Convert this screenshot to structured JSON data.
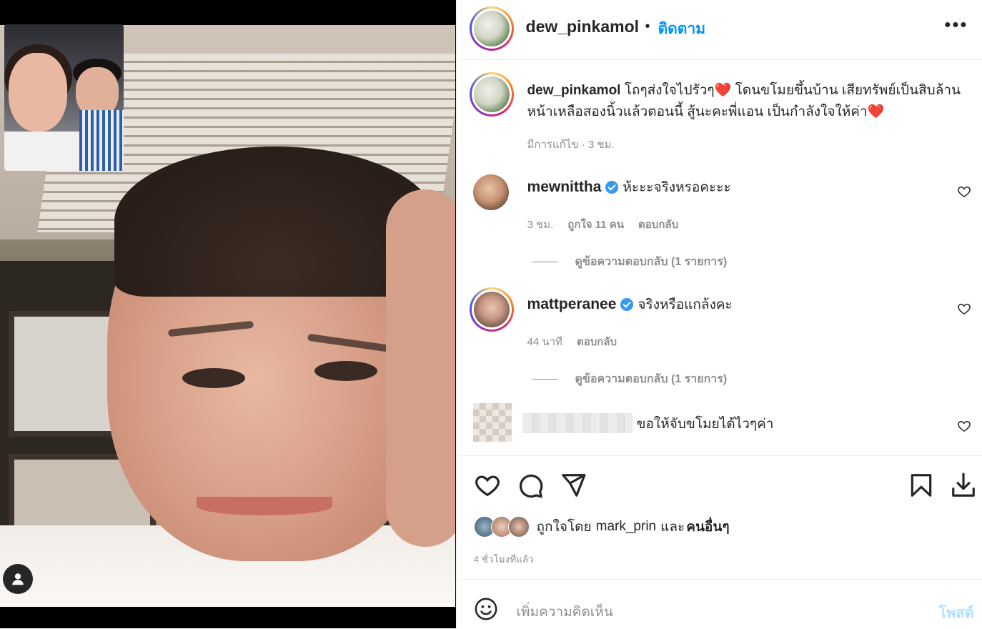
{
  "header": {
    "username": "dew_pinkamol",
    "separator": "•",
    "follow_label": "ติดตาม",
    "more_label": "•••"
  },
  "caption": {
    "username": "dew_pinkamol",
    "text": "โถๆส่งใจไปรัวๆ❤️ โดนขโมยขึ้นบ้าน เสียทรัพย์เป็นสิบล้าน หน้าเหลือสองนิ้วแล้วตอนนี้ สู้นะคะพี่แอน เป็นกำลังใจให้ค่า❤️",
    "meta": "มีการแก้ไข · 3 ชม."
  },
  "comments": [
    {
      "username": "mewnittha",
      "verified": true,
      "text": "ห้ะะะจริงหรอคะะะ",
      "time": "3 ชม.",
      "likes": "ถูกใจ 11 คน",
      "reply": "ตอบกลับ",
      "view_replies": "ดูข้อความตอบกลับ (1 รายการ)"
    },
    {
      "username": "mattperanee",
      "verified": true,
      "text": "จริงหรือแกล้งคะ",
      "time": "44 นาที",
      "reply": "ตอบกลับ",
      "view_replies": "ดูข้อความตอบกลับ (1 รายการ)"
    },
    {
      "username": "",
      "text": "ขอให้จับขโมยได้ไวๆค่า"
    }
  ],
  "actions": {
    "liked_prefix": "ถูกใจโดย",
    "liked_user": "mark_prin",
    "liked_and": "และ",
    "liked_others": "คนอื่นๆ",
    "time_ago": "4 ชั่วโมงที่แล้ว"
  },
  "comment_box": {
    "placeholder": "เพิ่มความคิดเห็น",
    "post_label": "โพสต์"
  },
  "icons": {
    "like": "heart-icon",
    "comment": "comment-icon",
    "share": "share-icon",
    "save": "bookmark-icon",
    "download": "download-icon",
    "emoji": "emoji-icon",
    "user_tag": "user-tag-icon"
  },
  "colors": {
    "link_blue": "#0095f6",
    "post_disabled": "#b2dffc",
    "verified": "#3897f0",
    "heart_red": "#e0245e"
  }
}
